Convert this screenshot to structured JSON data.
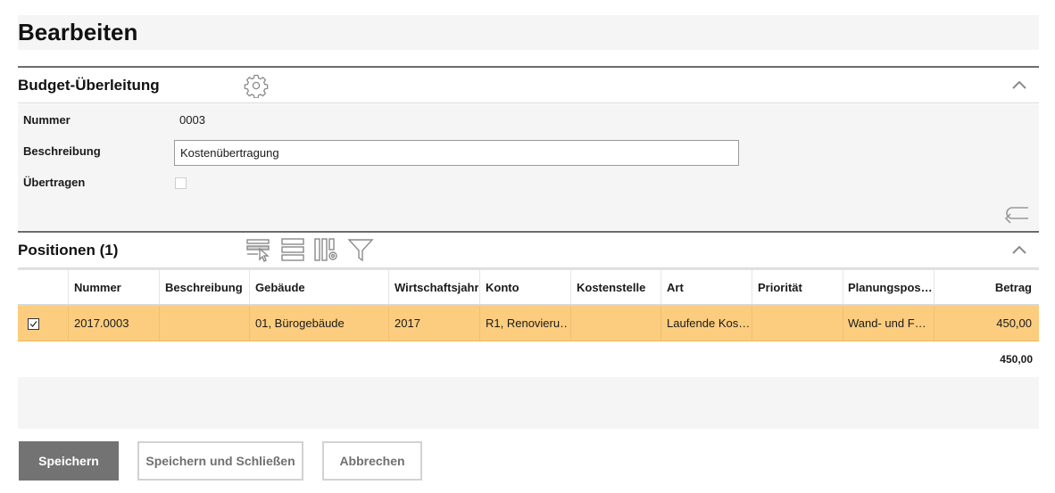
{
  "page": {
    "title": "Bearbeiten"
  },
  "budget": {
    "section_title": "Budget-Überleitung",
    "fields": {
      "nummer_label": "Nummer",
      "nummer_value": "0003",
      "beschreibung_label": "Beschreibung",
      "beschreibung_value": "Kostenübertragung",
      "uebertragen_label": "Übertragen",
      "uebertragen_checked": false
    }
  },
  "positions": {
    "section_title": "Positionen (1)",
    "columns": [
      "Nummer",
      "Beschreibung",
      "Gebäude",
      "Wirtschaftsjahr",
      "Konto",
      "Kostenstelle",
      "Art",
      "Priorität",
      "Planungspos…",
      "Betrag"
    ],
    "rows": [
      {
        "selected": true,
        "cells": [
          "2017.0003",
          "",
          "01, Bürogebäude",
          "2017",
          "R1, Renovieru…",
          "",
          "Laufende Kos…",
          "",
          "Wand- und F…",
          "450,00"
        ]
      }
    ],
    "total": "450,00"
  },
  "buttons": {
    "save": "Speichern",
    "save_close": "Speichern und Schließen",
    "cancel": "Abbrechen"
  },
  "icons": {
    "settings": "gear-icon",
    "collapse": "chevron-up-icon",
    "undo": "return-arrow-icon",
    "select_rows": "row-select-icon",
    "rows_layout": "rows-layout-icon",
    "column_settings": "column-settings-icon",
    "filter": "filter-icon"
  },
  "colors": {
    "selected_row": "#fccd7e",
    "primary_button": "#737373",
    "panel_background": "#f5f5f5"
  }
}
